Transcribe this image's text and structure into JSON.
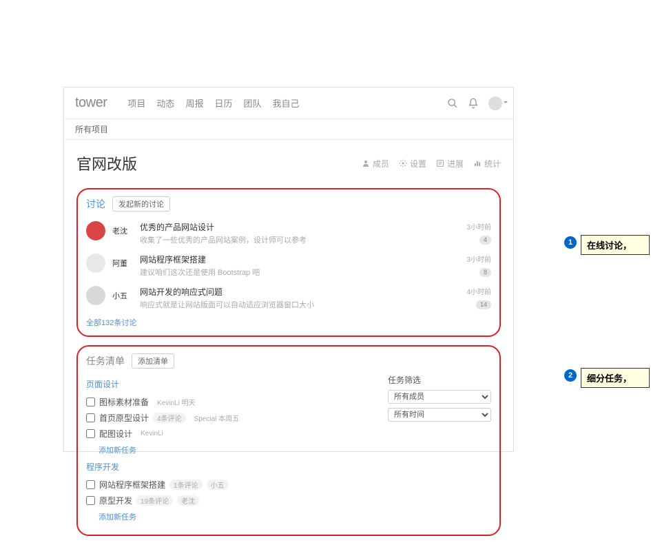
{
  "logo": "tower",
  "nav": [
    "项目",
    "动态",
    "周报",
    "日历",
    "团队",
    "我自己"
  ],
  "breadcrumb": "所有项目",
  "project": {
    "title": "官网改版",
    "actions": [
      "成员",
      "设置",
      "进展",
      "统计"
    ]
  },
  "discussion": {
    "title": "讨论",
    "new_btn": "发起新的讨论",
    "all_link": "全部132条讨论",
    "items": [
      {
        "user": "老沈",
        "title": "优秀的产品网站设计",
        "sub": "收集了一些优秀的产品网站案例，设计师可以参考",
        "time": "3小时前",
        "badge": "4"
      },
      {
        "user": "阿董",
        "title": "网站程序框架搭建",
        "sub": "建议咱们这次还是使用 Bootstrap 吧",
        "time": "3小时前",
        "badge": "8"
      },
      {
        "user": "小五",
        "title": "网站开发的响应式问题",
        "sub": "响应式就是让网站版面可以自动适应浏览器窗口大小",
        "time": "4小时前",
        "badge": "14"
      }
    ]
  },
  "tasks": {
    "title": "任务清单",
    "add_list_btn": "添加清单",
    "add_task": "添加新任务",
    "filter_title": "任务筛选",
    "filter_member": "所有成员",
    "filter_time": "所有时间",
    "groups": [
      {
        "name": "页面设计",
        "items": [
          {
            "name": "图标素材准备",
            "tags": [
              "KevinLi 明天"
            ]
          },
          {
            "name": "首页原型设计",
            "tags": [
              "4条评论",
              "Special 本周五"
            ]
          },
          {
            "name": "配图设计",
            "tags": [
              "KevinLi"
            ]
          }
        ]
      },
      {
        "name": "程序开发",
        "items": [
          {
            "name": "网站程序框架搭建",
            "tags": [
              "1条评论",
              "小五"
            ]
          },
          {
            "name": "原型开发",
            "tags": [
              "19条评论",
              "老沈"
            ]
          }
        ]
      }
    ]
  },
  "callouts": {
    "c1": "在线讨论，",
    "c2": "细分任务，"
  }
}
